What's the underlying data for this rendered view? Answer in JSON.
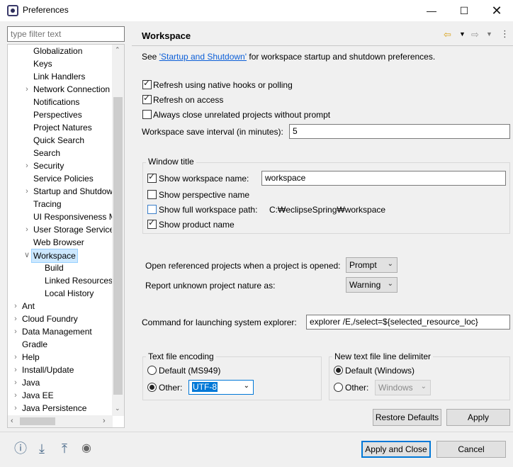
{
  "window": {
    "title": "Preferences",
    "minimize_icon": "minimize-icon",
    "maximize_icon": "maximize-icon",
    "close_icon": "close-icon"
  },
  "filter": {
    "placeholder": "type filter text"
  },
  "tree": {
    "items": [
      {
        "label": "Globalization",
        "expander": ""
      },
      {
        "label": "Keys",
        "expander": ""
      },
      {
        "label": "Link Handlers",
        "expander": ""
      },
      {
        "label": "Network Connection",
        "expander": ">"
      },
      {
        "label": "Notifications",
        "expander": ""
      },
      {
        "label": "Perspectives",
        "expander": ""
      },
      {
        "label": "Project Natures",
        "expander": ""
      },
      {
        "label": "Quick Search",
        "expander": ""
      },
      {
        "label": "Search",
        "expander": ""
      },
      {
        "label": "Security",
        "expander": ">"
      },
      {
        "label": "Service Policies",
        "expander": ""
      },
      {
        "label": "Startup and Shutdow",
        "expander": ">"
      },
      {
        "label": "Tracing",
        "expander": ""
      },
      {
        "label": "UI Responsiveness M",
        "expander": ""
      },
      {
        "label": "User Storage Service",
        "expander": ">"
      },
      {
        "label": "Web Browser",
        "expander": ""
      },
      {
        "label": "Workspace",
        "expander": "v"
      },
      {
        "label": "Build",
        "expander": ""
      },
      {
        "label": "Linked Resources",
        "expander": ""
      },
      {
        "label": "Local History",
        "expander": ""
      },
      {
        "label": "Ant",
        "expander": ">"
      },
      {
        "label": "Cloud Foundry",
        "expander": ">"
      },
      {
        "label": "Data Management",
        "expander": ">"
      },
      {
        "label": "Gradle",
        "expander": ""
      },
      {
        "label": "Help",
        "expander": ">"
      },
      {
        "label": "Install/Update",
        "expander": ">"
      },
      {
        "label": "Java",
        "expander": ">"
      },
      {
        "label": "Java EE",
        "expander": ">"
      },
      {
        "label": "Java Persistence",
        "expander": ">"
      }
    ]
  },
  "page": {
    "title": "Workspace",
    "see_prefix": "See ",
    "see_link": "'Startup and Shutdown'",
    "see_suffix": " for workspace startup and shutdown preferences.",
    "refresh_native": "Refresh using native hooks or polling",
    "refresh_access": "Refresh on access",
    "close_unrelated": "Always close unrelated projects without prompt",
    "save_interval_label": "Workspace save interval (in minutes):",
    "save_interval_value": "5",
    "window_title_group": "Window title",
    "show_ws_name": "Show workspace name:",
    "ws_name_value": "workspace",
    "show_perspective": "Show perspective name",
    "show_full_path": "Show full workspace path:",
    "full_path_value": "C:₩eclipseSpring₩workspace",
    "show_product": "Show product name",
    "open_ref_label": "Open referenced projects when a project is opened:",
    "open_ref_value": "Prompt",
    "unknown_nature_label": "Report unknown project nature as:",
    "unknown_nature_value": "Warning",
    "cmd_label": "Command for launching system explorer:",
    "cmd_value": "explorer /E,/select=${selected_resource_loc}",
    "encoding_group": "Text file encoding",
    "enc_default": "Default (MS949)",
    "enc_other": "Other:",
    "enc_other_value": "UTF-8",
    "delim_group": "New text file line delimiter",
    "delim_default": "Default (Windows)",
    "delim_other": "Other:",
    "delim_other_value": "Windows",
    "restore_defaults": "Restore Defaults",
    "apply": "Apply"
  },
  "footer": {
    "apply_close": "Apply and Close",
    "cancel": "Cancel",
    "icons": [
      "help-icon",
      "import-icon",
      "export-icon",
      "record-icon"
    ]
  }
}
